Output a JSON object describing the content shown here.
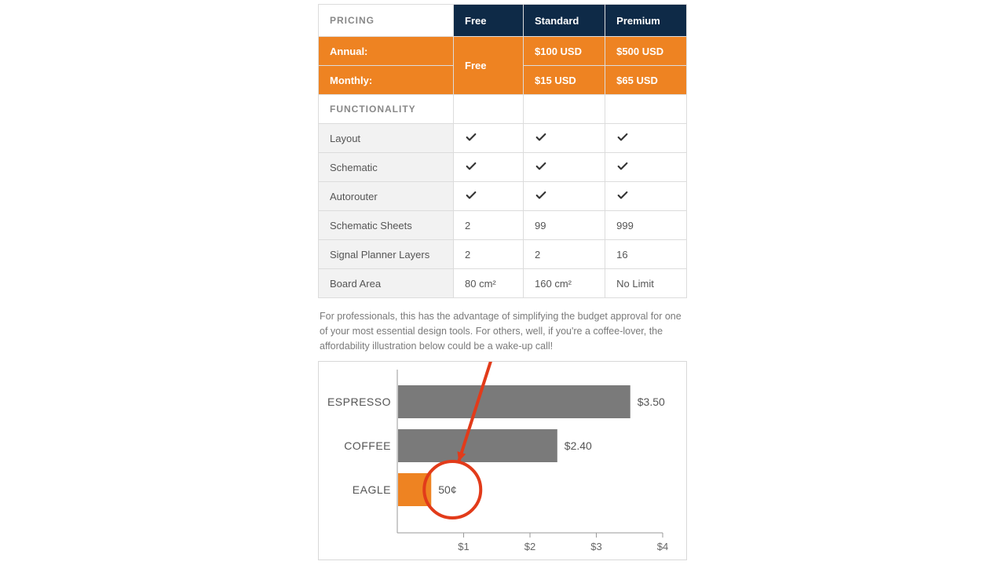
{
  "table": {
    "header": {
      "label": "PRICING",
      "plans": [
        "Free",
        "Standard",
        "Premium"
      ]
    },
    "annual": {
      "label": "Annual:",
      "free": "Free",
      "standard": "$100 USD",
      "premium": "$500 USD"
    },
    "monthly": {
      "label": "Monthly:",
      "standard": "$15 USD",
      "premium": "$65 USD"
    },
    "section": "FUNCTIONALITY",
    "rows": [
      {
        "label": "Layout",
        "free": "check",
        "standard": "check",
        "premium": "check"
      },
      {
        "label": "Schematic",
        "free": "check",
        "standard": "check",
        "premium": "check"
      },
      {
        "label": "Autorouter",
        "free": "check",
        "standard": "check",
        "premium": "check"
      },
      {
        "label": "Schematic Sheets",
        "free": "2",
        "standard": "99",
        "premium": "999"
      },
      {
        "label": "Signal Planner Layers",
        "free": "2",
        "standard": "2",
        "premium": "16"
      },
      {
        "label": "Board Area",
        "free": "80 cm²",
        "standard": "160 cm²",
        "premium": "No Limit"
      }
    ]
  },
  "blurb": "For professionals, this has the advantage of simplifying the budget approval for one of your most essential design tools. For others, well, if you're a coffee-lover, the affordability illustration below could be a wake-up call!",
  "chart_data": {
    "type": "bar",
    "orientation": "horizontal",
    "categories": [
      "ESPRESSO",
      "COFFEE",
      "EAGLE"
    ],
    "values": [
      3.5,
      2.4,
      0.5
    ],
    "value_labels": [
      "$3.50",
      "$2.40",
      "50¢"
    ],
    "colors": [
      "#7a7a7a",
      "#7a7a7a",
      "#ee8322"
    ],
    "x_ticks": [
      1,
      2,
      3,
      4
    ],
    "x_tick_labels": [
      "$1",
      "$2",
      "$3",
      "$4"
    ],
    "xlim": [
      0,
      4
    ],
    "highlight_index": 2
  }
}
